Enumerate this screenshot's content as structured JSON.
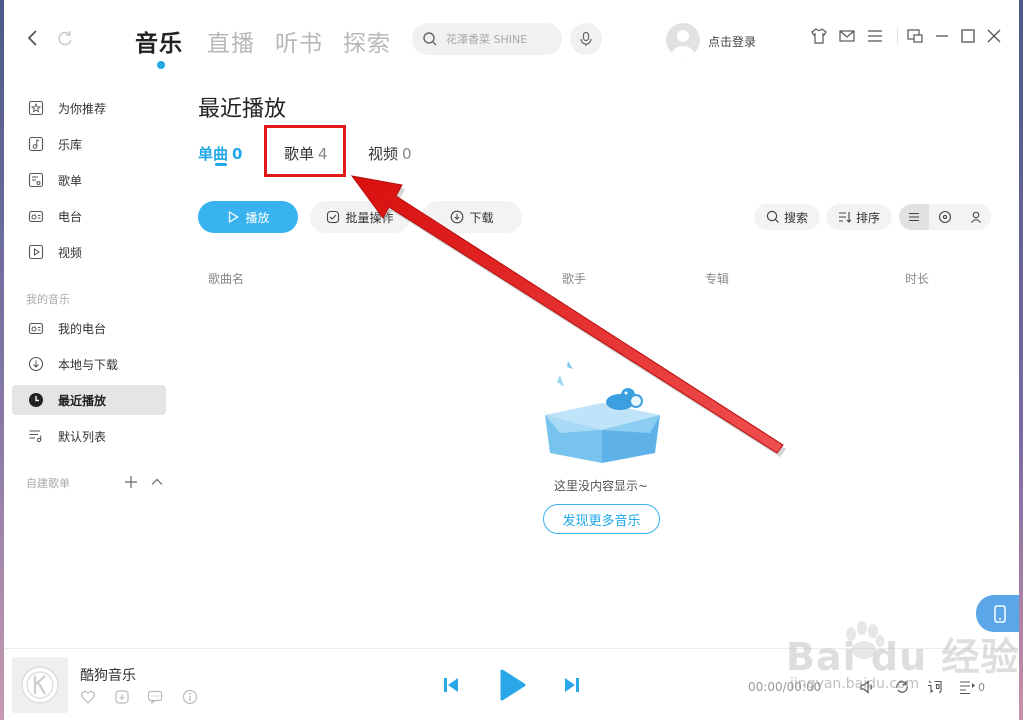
{
  "header": {
    "tabs": [
      {
        "label": "音乐",
        "active": true
      },
      {
        "label": "直播",
        "active": false
      },
      {
        "label": "听书",
        "active": false
      },
      {
        "label": "探索",
        "active": false
      }
    ],
    "search_placeholder": "花澤香菜 SHINE",
    "login_label": "点击登录"
  },
  "sidebar": {
    "items": [
      {
        "label": "为你推荐",
        "icon": "star-icon"
      },
      {
        "label": "乐库",
        "icon": "music-note-icon"
      },
      {
        "label": "歌单",
        "icon": "playlist-icon"
      },
      {
        "label": "电台",
        "icon": "radio-icon"
      },
      {
        "label": "视频",
        "icon": "video-icon"
      }
    ],
    "my_music_label": "我的音乐",
    "my_items": [
      {
        "label": "我的电台",
        "icon": "radio-icon"
      },
      {
        "label": "本地与下载",
        "icon": "download-icon"
      },
      {
        "label": "最近播放",
        "icon": "clock-icon",
        "active": true
      },
      {
        "label": "默认列表",
        "icon": "list-icon"
      }
    ],
    "custom_playlists_label": "自建歌单"
  },
  "main": {
    "title": "最近播放",
    "sub_tabs": [
      {
        "label": "单曲",
        "count": "0",
        "active": true
      },
      {
        "label": "歌单",
        "count": "4",
        "active": false
      },
      {
        "label": "视频",
        "count": "0",
        "active": false
      }
    ],
    "actions": {
      "play": "播放",
      "batch": "批量操作",
      "download": "下载",
      "search": "搜索",
      "sort": "排序"
    },
    "columns": {
      "song": "歌曲名",
      "artist": "歌手",
      "album": "专辑",
      "duration": "时长"
    },
    "empty_text": "这里没内容显示~",
    "discover_label": "发现更多音乐"
  },
  "player": {
    "song_title": "酷狗音乐",
    "time": "00:00/00:00",
    "queue_count": "0"
  },
  "watermark": {
    "brand": "Bai du 经验",
    "url": "jingyan.baidu.com"
  },
  "colors": {
    "accent": "#20a8e8",
    "primary_button": "#37b3f0",
    "annotation_red": "#e01818"
  }
}
